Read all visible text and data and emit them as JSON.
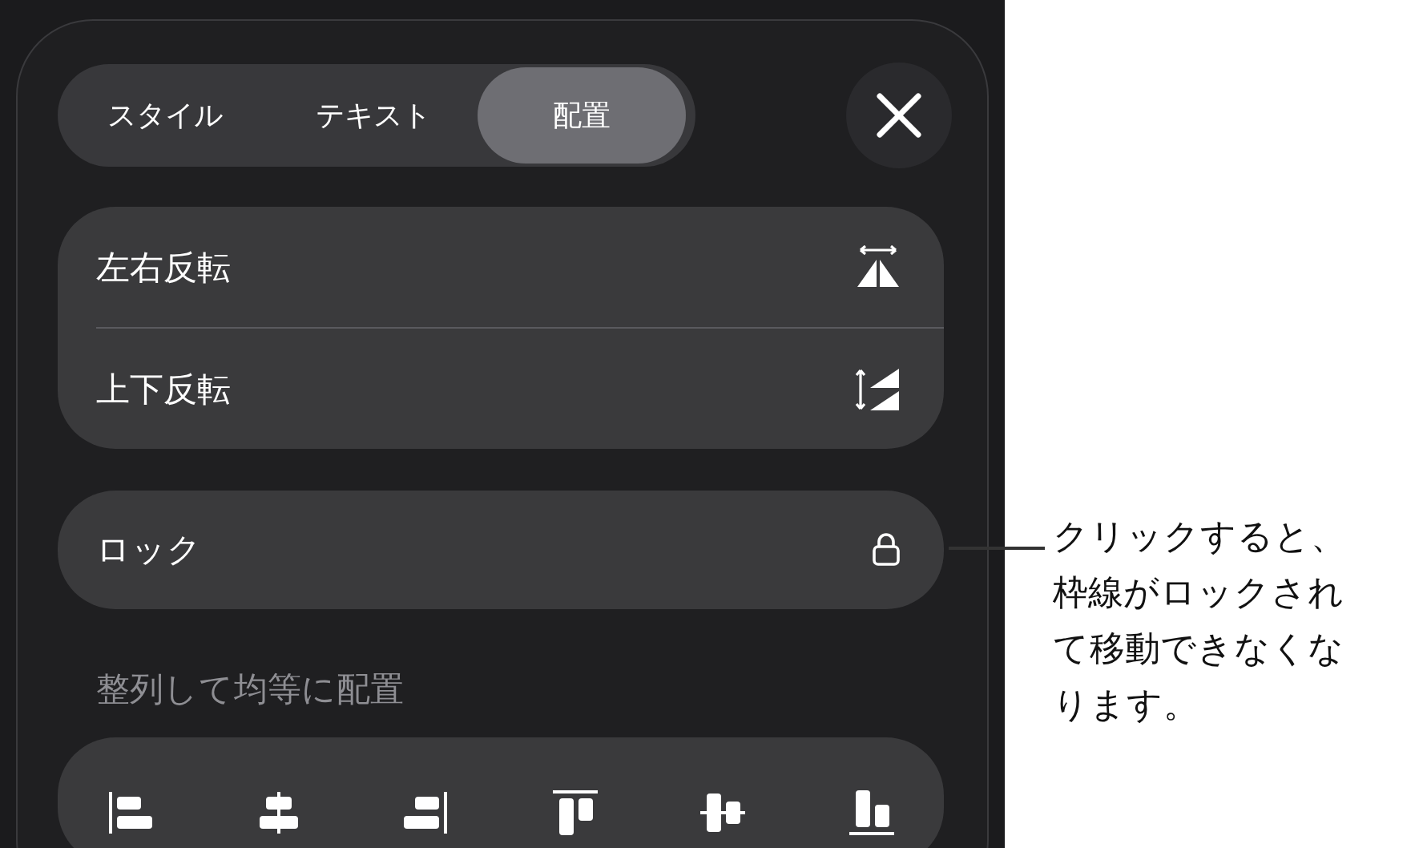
{
  "tabs": [
    {
      "label": "スタイル",
      "selected": false
    },
    {
      "label": "テキスト",
      "selected": false
    },
    {
      "label": "配置",
      "selected": true
    }
  ],
  "flip_items": [
    {
      "label": "左右反転",
      "kind": "horizontal"
    },
    {
      "label": "上下反転",
      "kind": "vertical"
    }
  ],
  "lock": {
    "label": "ロック"
  },
  "section_title": "整列して均等に配置",
  "align_buttons": [
    {
      "kind": "left"
    },
    {
      "kind": "center"
    },
    {
      "kind": "right"
    },
    {
      "kind": "top"
    },
    {
      "kind": "middle"
    },
    {
      "kind": "bottom"
    }
  ],
  "callout": "クリックすると、枠線がロックされて移動できなくなります。"
}
